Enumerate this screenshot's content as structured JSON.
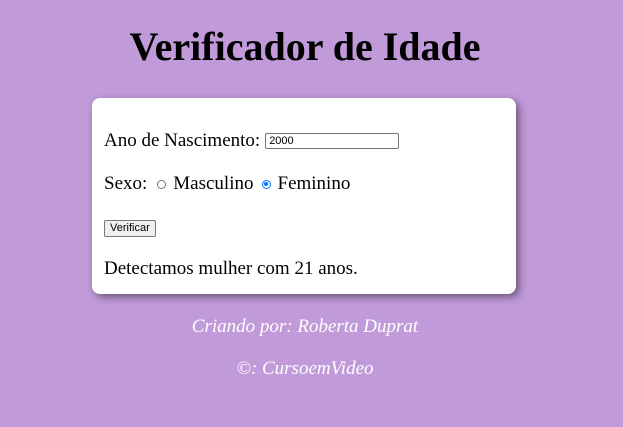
{
  "header": {
    "title": "Verificador de Idade"
  },
  "form": {
    "year_label": "Ano de Nascimento:",
    "year_value": "2000",
    "sex_label": "Sexo:",
    "option_male": "Masculino",
    "option_female": "Feminino",
    "selected_option": "Feminino",
    "button_label": "Verificar",
    "result_text": "Detectamos mulher com 21 anos."
  },
  "footer": {
    "author": "Criando por: Roberta Duprat",
    "copyright": "©: CursoemVideo"
  },
  "colors": {
    "background": "#c09ad9",
    "card": "#ffffff",
    "radio_accent": "#0075ff"
  }
}
